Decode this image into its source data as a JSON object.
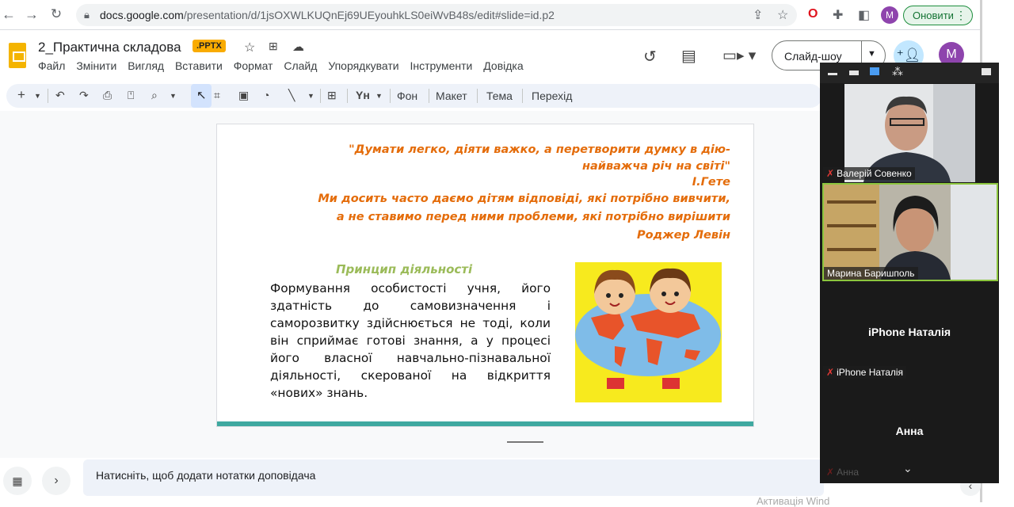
{
  "browser": {
    "url_domain": "docs.google.com",
    "url_path": "/presentation/d/1jsOXWLKUQnEj69UEyouhkLS0eiWvB48s/edit#slide=id.p2",
    "profile_initial": "M",
    "update_label": "Оновити"
  },
  "doc": {
    "title": "2_Практична складова",
    "badge": ".PPTX",
    "menu": [
      "Файл",
      "Змінити",
      "Вигляд",
      "Вставити",
      "Формат",
      "Слайд",
      "Упорядкувати",
      "Інструменти",
      "Довідка"
    ],
    "slideshow_label": "Слайд-шоу",
    "account_initial": "M"
  },
  "toolbar": {
    "background": "Фон",
    "layout": "Макет",
    "theme": "Тема",
    "transition": "Перехід"
  },
  "slide": {
    "quote1_line1": "\"Думати легко, діяти важко, а перетворити думку в дію-",
    "quote1_line2": "найважча річ на світі\"",
    "quote1_author": "І.Гете",
    "quote2_line1": "Ми досить часто даємо дітям відповіді, які потрібно вивчити,",
    "quote2_line2": "а не ставимо перед ними проблеми, які потрібно вирішити",
    "quote2_author": "Роджер Левін",
    "principle_title": "Принцип діяльності",
    "principle_text": "Формування особистості учня, його здатність до самовизначення і саморозвитку здійснюється не тоді, коли він сприймає готові знання, а у процесі його власної навчально-пізнавальної діяльності, скерованої на відкриття «нових» знань.",
    "accent_color": "#e46c0a",
    "principle_color": "#9bbb59"
  },
  "notes": {
    "placeholder": "Натисніть, щоб додати нотатки доповідача"
  },
  "zoom": {
    "participants": [
      {
        "name": "Валерій Совенко",
        "muted": true
      },
      {
        "name": "Марина Баришполь",
        "muted": false
      },
      {
        "name": "iPhone Наталія",
        "muted": true
      },
      {
        "name": "Анна",
        "muted": true
      }
    ]
  },
  "watermark": "Активація Wind"
}
